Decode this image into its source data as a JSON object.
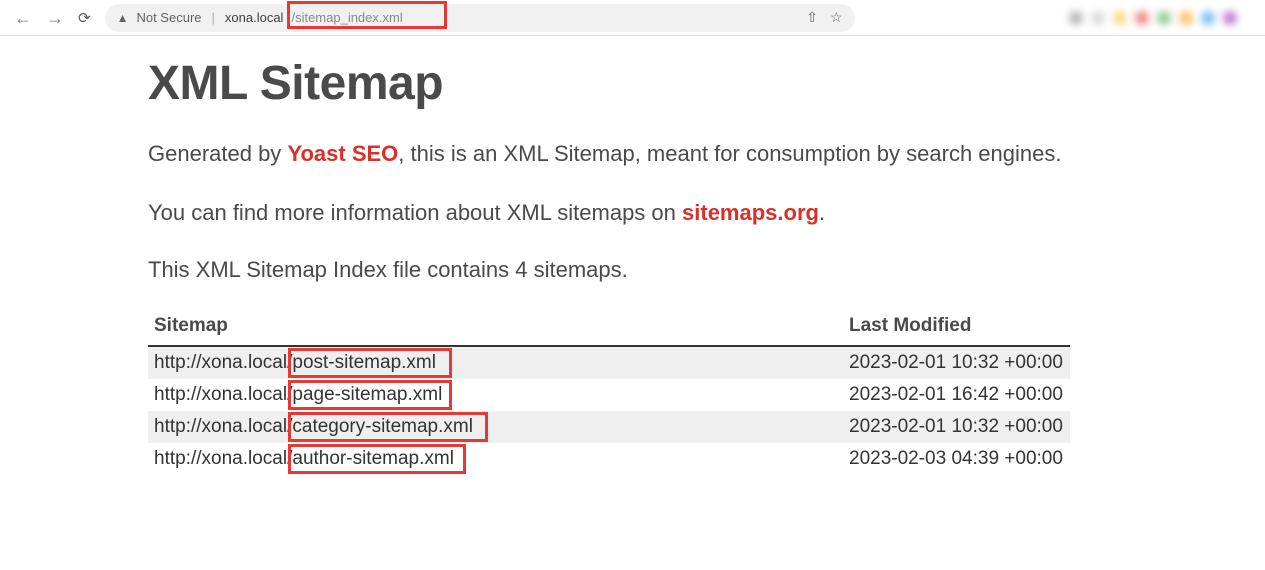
{
  "browser": {
    "not_secure_label": "Not Secure",
    "url_domain": "xona.local",
    "url_path": "/sitemap_index.xml"
  },
  "page": {
    "title": "XML Sitemap",
    "generated_prefix": "Generated by ",
    "generated_link": "Yoast SEO",
    "generated_suffix": ", this is an XML Sitemap, meant for consumption by search engines.",
    "more_info_prefix": "You can find more information about XML sitemaps on ",
    "more_info_link": "sitemaps.org",
    "more_info_suffix": ".",
    "count_line": "This XML Sitemap Index file contains 4 sitemaps."
  },
  "table": {
    "headers": {
      "sitemap": "Sitemap",
      "last_modified": "Last Modified"
    },
    "rows": [
      {
        "prefix": "http://xona.local/",
        "file": "post-sitemap.xml",
        "modified": "2023-02-01 10:32 +00:00"
      },
      {
        "prefix": "http://xona.local/",
        "file": "page-sitemap.xml",
        "modified": "2023-02-01 16:42 +00:00"
      },
      {
        "prefix": "http://xona.local/",
        "file": "category-sitemap.xml",
        "modified": "2023-02-01 10:32 +00:00"
      },
      {
        "prefix": "http://xona.local/",
        "file": "author-sitemap.xml",
        "modified": "2023-02-03 04:39 +00:00"
      }
    ]
  }
}
